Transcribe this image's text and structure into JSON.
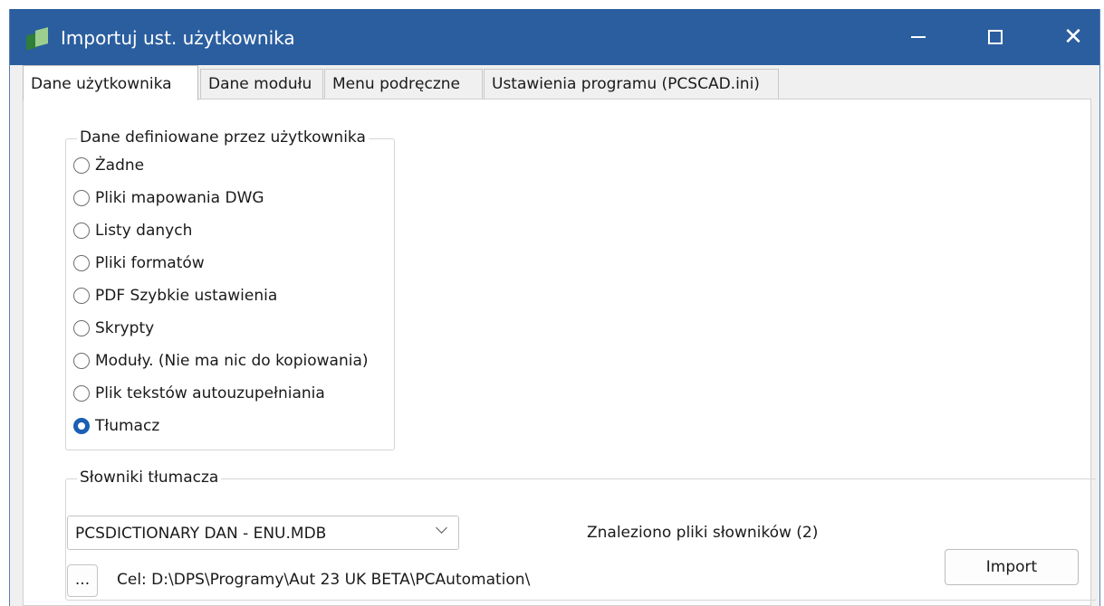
{
  "window": {
    "title": "Importuj ust. użytkownika"
  },
  "tabs": [
    {
      "label": "Dane użytkownika",
      "active": true
    },
    {
      "label": "Dane modułu",
      "active": false
    },
    {
      "label": "Menu podręczne",
      "active": false
    },
    {
      "label": "Ustawienia programu (PCSCAD.ini)",
      "active": false
    }
  ],
  "user_data_group": {
    "title": "Dane definiowane przez użytkownika",
    "options": [
      {
        "label": "Żadne",
        "checked": false
      },
      {
        "label": "Pliki mapowania DWG",
        "checked": false
      },
      {
        "label": "Listy danych",
        "checked": false
      },
      {
        "label": "Pliki formatów",
        "checked": false
      },
      {
        "label": "PDF Szybkie ustawienia",
        "checked": false
      },
      {
        "label": "Skrypty",
        "checked": false
      },
      {
        "label": "Moduły. (Nie ma nic do kopiowania)",
        "checked": false
      },
      {
        "label": "Plik tekstów autouzupełniania",
        "checked": false
      },
      {
        "label": "Tłumacz",
        "checked": true
      }
    ]
  },
  "dictionaries_group": {
    "title": "Słowniki tłumacza",
    "dictionary_select_value": "PCSDICTIONARY DAN - ENU.MDB",
    "found_text": "Znaleziono pliki słowników (2)",
    "browse_label": "...",
    "target_text": "Cel: D:\\DPS\\Programy\\Aut 23 UK BETA\\PCAutomation\\",
    "import_label": "Import"
  },
  "colors": {
    "titlebar": "#2b5e9f",
    "radio_checked": "#1a5fb4"
  },
  "icons": {
    "app": "app-icon",
    "minimize": "minimize-icon",
    "maximize": "maximize-icon",
    "close": "close-icon",
    "dropdown": "chevron-down-icon"
  }
}
